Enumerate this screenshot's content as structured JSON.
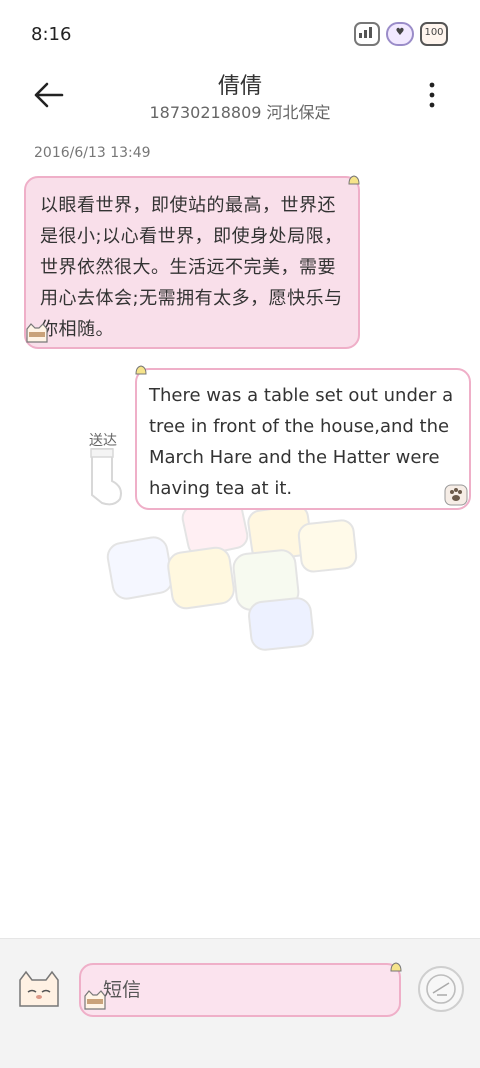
{
  "status_bar": {
    "time": "8:16",
    "icons": [
      "signal-icon",
      "heart-battery-icon",
      "dog-100-icon"
    ]
  },
  "header": {
    "contact_name": "倩倩",
    "contact_detail": "18730218809 河北保定",
    "back_icon": "back-arrow-icon",
    "more_icon": "more-vertical-icon"
  },
  "conversation": {
    "timestamp": "2016/6/13 13:49",
    "messages": [
      {
        "direction": "incoming",
        "text": "以眼看世界，即使站的最高，世界还是很小;以心看世界，即使身处局限，世界依然很大。生活远不完美，需要用心去体会;无需拥有太多，愿快乐与你相随。"
      },
      {
        "direction": "outgoing",
        "status": "送达",
        "text": "There was a table set out under a tree in front of the house,and the March Hare and the Hatter were having tea at it."
      }
    ]
  },
  "composer": {
    "placeholder": "短信",
    "send_icon": "send-icon",
    "avatar_icon": "cat-avatar-icon"
  },
  "colors": {
    "bubble_border": "#efafc8",
    "bubble_in_bg": "#f9dfea",
    "composer_bg": "#f3f3f3"
  }
}
